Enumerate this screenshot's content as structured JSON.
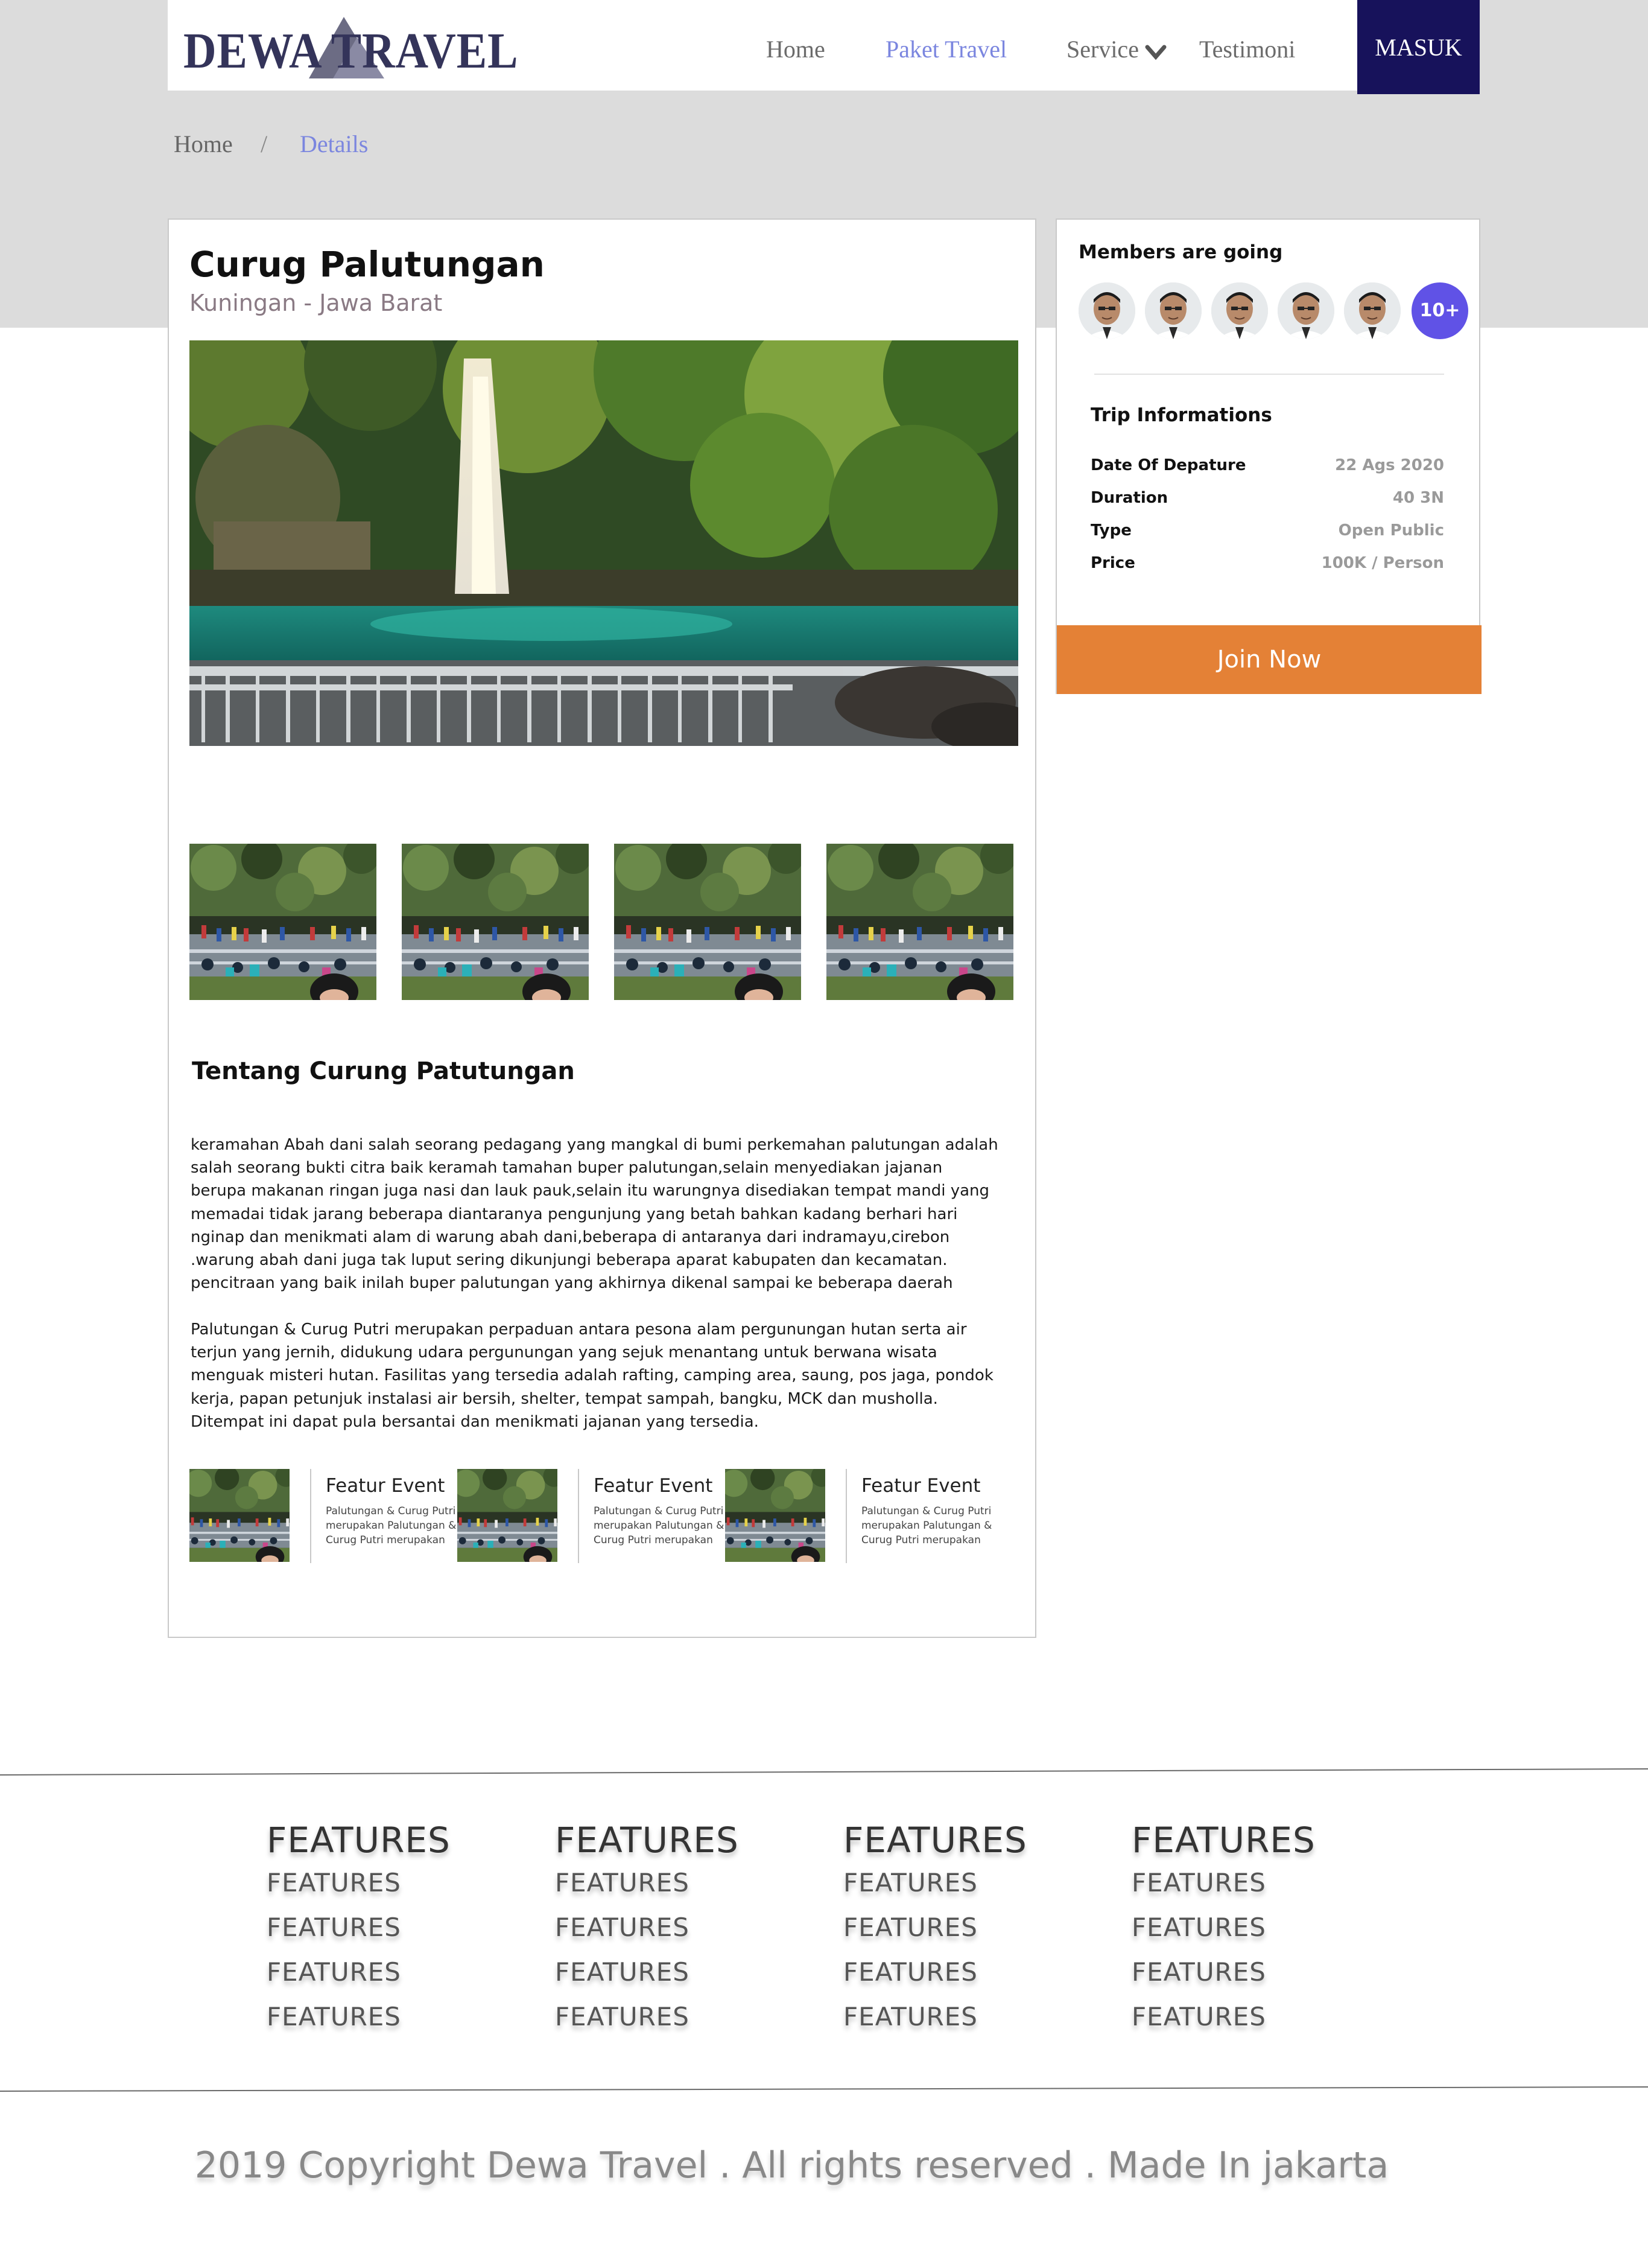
{
  "brand": {
    "name": "DEWA TRAVEL",
    "color": "#34345a"
  },
  "nav": {
    "items": [
      "Home",
      "Paket Travel",
      "Service",
      "Testimoni"
    ],
    "active_color": "#7b86df",
    "login_label": "MASUK",
    "login_color": "#17125b"
  },
  "breadcrumb": {
    "home": "Home",
    "separator": "/",
    "current": "Details"
  },
  "destination": {
    "title": "Curug Palutungan",
    "location": "Kuningan - Jawa Barat",
    "about_title": "Tentang Curung Patutungan",
    "paragraphs": [
      "keramahan Abah dani salah seorang pedagang yang mangkal di bumi perkemahan palutungan adalah salah seorang bukti citra baik keramah tamahan buper palutungan,selain menyediakan jajanan berupa makanan ringan juga nasi dan lauk pauk,selain itu warungnya disediakan tempat mandi yang memadai tidak jarang beberapa diantaranya pengunjung yang betah bahkan kadang berhari hari nginap dan menikmati alam di warung abah dani,beberapa di antaranya dari indramayu,cirebon .warung abah dani juga tak luput sering dikunjungi beberapa aparat kabupaten dan kecamatan. pencitraan yang baik inilah buper palutungan yang akhirnya dikenal sampai ke beberapa daerah",
      "Palutungan & Curug Putri merupakan perpaduan antara pesona alam pergunungan hutan serta air terjun yang jernih, didukung udara pergunungan yang sejuk menantang untuk berwana wisata menguak misteri hutan. Fasilitas yang tersedia adalah rafting, camping area, saung, pos jaga, pondok kerja, papan petunjuk instalasi air bersih, shelter, tempat sampah, bangku, MCK dan musholla. Ditempat ini dapat pula bersantai dan menikmati jajanan yang tersedia."
    ],
    "features": [
      {
        "title": "Featur Event",
        "desc": "Palutungan & Curug Putri merupakan Palutungan & Curug Putri merupakan"
      },
      {
        "title": "Featur Event",
        "desc": "Palutungan & Curug Putri merupakan Palutungan & Curug Putri merupakan"
      },
      {
        "title": "Featur Event",
        "desc": "Palutungan & Curug Putri merupakan Palutungan & Curug Putri merupakan"
      }
    ]
  },
  "members": {
    "title": "Members are going",
    "more_label": "10+",
    "more_color": "#6052e6"
  },
  "trip": {
    "title": "Trip Informations",
    "rows": [
      {
        "label": "Date Of Depature",
        "value": "22 Ags 2020"
      },
      {
        "label": "Duration",
        "value": "40 3N"
      },
      {
        "label": "Type",
        "value": "Open Public"
      },
      {
        "label": "Price",
        "value": "100K / Person"
      }
    ],
    "join_label": "Join Now",
    "join_color": "#e48136"
  },
  "footer": {
    "columns": [
      {
        "heading": "FEATURES",
        "items": [
          "FEATURES",
          "FEATURES",
          "FEATURES",
          "FEATURES"
        ]
      },
      {
        "heading": "FEATURES",
        "items": [
          "FEATURES",
          "FEATURES",
          "FEATURES",
          "FEATURES"
        ]
      },
      {
        "heading": "FEATURES",
        "items": [
          "FEATURES",
          "FEATURES",
          "FEATURES",
          "FEATURES"
        ]
      },
      {
        "heading": "FEATURES",
        "items": [
          "FEATURES",
          "FEATURES",
          "FEATURES",
          "FEATURES"
        ]
      }
    ],
    "copyright": "2019 Copyright Dewa Travel . All rights reserved . Made In jakarta"
  }
}
